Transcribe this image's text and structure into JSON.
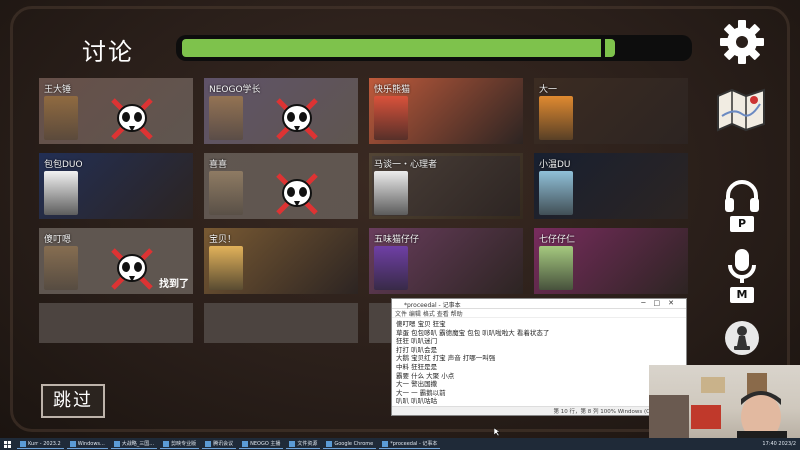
{
  "header": {
    "title": "讨论",
    "progress": 0.86
  },
  "cards": [
    {
      "name": "王大锤",
      "state": "dead",
      "bg": "#6a4840",
      "avatar": "#c48a35"
    },
    {
      "name": "NEOGO学长",
      "state": "dead",
      "bg": "#5d4d7a",
      "avatar": "#d39a3e"
    },
    {
      "name": "快乐熊猫",
      "state": "alive",
      "bg": "#c45b3b",
      "avatar": "#d9523b"
    },
    {
      "name": "大一",
      "state": "alive",
      "bg": "#3a2a20",
      "avatar": "#e08a30"
    },
    {
      "name": "包包DUO",
      "state": "alive",
      "bg": "#1f2d55",
      "avatar": "#f2f2f2"
    },
    {
      "name": "喜喜",
      "state": "dead",
      "bg": "#5f554e",
      "avatar": "#c7a77a"
    },
    {
      "name": "马谈一・心理者",
      "state": "alive",
      "bg": "#4a3f38",
      "avatar": "#ececec"
    },
    {
      "name": "小温DU",
      "state": "alive",
      "bg": "#141d2f",
      "avatar": "#90c0d8"
    },
    {
      "name": "傻叮嗯",
      "state": "dead",
      "bg": "#5d534c",
      "avatar": "#b58a52",
      "found": "找到了"
    },
    {
      "name": "宝贝！",
      "state": "alive",
      "bg": "#7a5a32",
      "avatar": "#e2b25a"
    },
    {
      "name": "五味猫仔仔",
      "state": "alive",
      "bg": "#6a3c5e",
      "avatar": "#6f3fa5"
    },
    {
      "name": "七仔仔仁",
      "state": "alive",
      "bg": "#7a2a5f",
      "avatar": "#a5c97f"
    },
    {
      "name": "",
      "state": "empty",
      "bg": "#4c4440",
      "avatar": ""
    },
    {
      "name": "",
      "state": "empty",
      "bg": "#4c4440",
      "avatar": ""
    },
    {
      "name": "",
      "state": "empty",
      "bg": "#4c4440",
      "avatar": ""
    }
  ],
  "sidebar": {
    "push_to_talk_key": "P",
    "mute_key": "M"
  },
  "skip_label": "跳过",
  "notepad": {
    "title": "*proceedal - 记事本",
    "menu": "文件  编辑  格式  查看  帮助",
    "lines": [
      "傻叮嗯 宝贝 狂宝",
      "草蛋 包包哆叭 霸德魔宝        包包 叭叭啦啦大         看着状态了",
      "狂狂 叭叭迷门",
      "打打 叭叭会是",
      "大鹅 宝贝红 打宝 声音 打哪一叫强",
      "中料 狂狂是是",
      "霸要 什么 大聚 小点",
      "大一 警出国撒",
      "大一 一 霸鹅以前",
      "叭叭 叭叭咕咕"
    ],
    "status": "第 10 行，第 8 列    100%    Windows (CRLF)    UTF-8"
  },
  "taskbar": {
    "items": [
      "Kurr - 2023.2",
      "Windows...",
      "大战略_三国...",
      "剪映专业版",
      "腾讯会议",
      "NEOGO 主播",
      "文件资源",
      "Google Chrome",
      "*proceedal - 记事本"
    ],
    "tray": "17:40  2023/2"
  },
  "colors": {
    "accent": "#7ec24c",
    "highlight": "#f2b500"
  }
}
